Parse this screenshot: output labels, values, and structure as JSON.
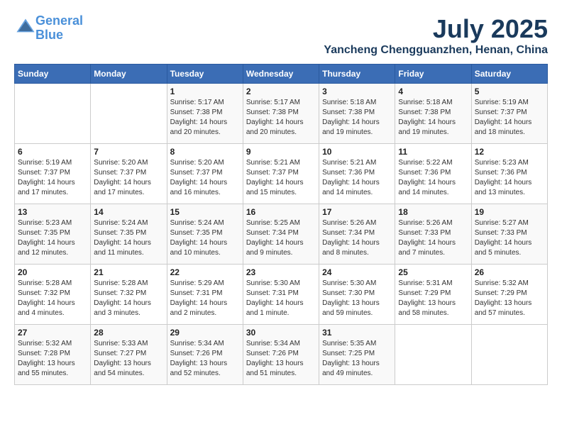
{
  "logo": {
    "line1": "General",
    "line2": "Blue"
  },
  "title": "July 2025",
  "location": "Yancheng Chengguanzhen, Henan, China",
  "days_of_week": [
    "Sunday",
    "Monday",
    "Tuesday",
    "Wednesday",
    "Thursday",
    "Friday",
    "Saturday"
  ],
  "weeks": [
    [
      {
        "day": "",
        "info": ""
      },
      {
        "day": "",
        "info": ""
      },
      {
        "day": "1",
        "info": "Sunrise: 5:17 AM\nSunset: 7:38 PM\nDaylight: 14 hours and 20 minutes."
      },
      {
        "day": "2",
        "info": "Sunrise: 5:17 AM\nSunset: 7:38 PM\nDaylight: 14 hours and 20 minutes."
      },
      {
        "day": "3",
        "info": "Sunrise: 5:18 AM\nSunset: 7:38 PM\nDaylight: 14 hours and 19 minutes."
      },
      {
        "day": "4",
        "info": "Sunrise: 5:18 AM\nSunset: 7:38 PM\nDaylight: 14 hours and 19 minutes."
      },
      {
        "day": "5",
        "info": "Sunrise: 5:19 AM\nSunset: 7:37 PM\nDaylight: 14 hours and 18 minutes."
      }
    ],
    [
      {
        "day": "6",
        "info": "Sunrise: 5:19 AM\nSunset: 7:37 PM\nDaylight: 14 hours and 17 minutes."
      },
      {
        "day": "7",
        "info": "Sunrise: 5:20 AM\nSunset: 7:37 PM\nDaylight: 14 hours and 17 minutes."
      },
      {
        "day": "8",
        "info": "Sunrise: 5:20 AM\nSunset: 7:37 PM\nDaylight: 14 hours and 16 minutes."
      },
      {
        "day": "9",
        "info": "Sunrise: 5:21 AM\nSunset: 7:37 PM\nDaylight: 14 hours and 15 minutes."
      },
      {
        "day": "10",
        "info": "Sunrise: 5:21 AM\nSunset: 7:36 PM\nDaylight: 14 hours and 14 minutes."
      },
      {
        "day": "11",
        "info": "Sunrise: 5:22 AM\nSunset: 7:36 PM\nDaylight: 14 hours and 14 minutes."
      },
      {
        "day": "12",
        "info": "Sunrise: 5:23 AM\nSunset: 7:36 PM\nDaylight: 14 hours and 13 minutes."
      }
    ],
    [
      {
        "day": "13",
        "info": "Sunrise: 5:23 AM\nSunset: 7:35 PM\nDaylight: 14 hours and 12 minutes."
      },
      {
        "day": "14",
        "info": "Sunrise: 5:24 AM\nSunset: 7:35 PM\nDaylight: 14 hours and 11 minutes."
      },
      {
        "day": "15",
        "info": "Sunrise: 5:24 AM\nSunset: 7:35 PM\nDaylight: 14 hours and 10 minutes."
      },
      {
        "day": "16",
        "info": "Sunrise: 5:25 AM\nSunset: 7:34 PM\nDaylight: 14 hours and 9 minutes."
      },
      {
        "day": "17",
        "info": "Sunrise: 5:26 AM\nSunset: 7:34 PM\nDaylight: 14 hours and 8 minutes."
      },
      {
        "day": "18",
        "info": "Sunrise: 5:26 AM\nSunset: 7:33 PM\nDaylight: 14 hours and 7 minutes."
      },
      {
        "day": "19",
        "info": "Sunrise: 5:27 AM\nSunset: 7:33 PM\nDaylight: 14 hours and 5 minutes."
      }
    ],
    [
      {
        "day": "20",
        "info": "Sunrise: 5:28 AM\nSunset: 7:32 PM\nDaylight: 14 hours and 4 minutes."
      },
      {
        "day": "21",
        "info": "Sunrise: 5:28 AM\nSunset: 7:32 PM\nDaylight: 14 hours and 3 minutes."
      },
      {
        "day": "22",
        "info": "Sunrise: 5:29 AM\nSunset: 7:31 PM\nDaylight: 14 hours and 2 minutes."
      },
      {
        "day": "23",
        "info": "Sunrise: 5:30 AM\nSunset: 7:31 PM\nDaylight: 14 hours and 1 minute."
      },
      {
        "day": "24",
        "info": "Sunrise: 5:30 AM\nSunset: 7:30 PM\nDaylight: 13 hours and 59 minutes."
      },
      {
        "day": "25",
        "info": "Sunrise: 5:31 AM\nSunset: 7:29 PM\nDaylight: 13 hours and 58 minutes."
      },
      {
        "day": "26",
        "info": "Sunrise: 5:32 AM\nSunset: 7:29 PM\nDaylight: 13 hours and 57 minutes."
      }
    ],
    [
      {
        "day": "27",
        "info": "Sunrise: 5:32 AM\nSunset: 7:28 PM\nDaylight: 13 hours and 55 minutes."
      },
      {
        "day": "28",
        "info": "Sunrise: 5:33 AM\nSunset: 7:27 PM\nDaylight: 13 hours and 54 minutes."
      },
      {
        "day": "29",
        "info": "Sunrise: 5:34 AM\nSunset: 7:26 PM\nDaylight: 13 hours and 52 minutes."
      },
      {
        "day": "30",
        "info": "Sunrise: 5:34 AM\nSunset: 7:26 PM\nDaylight: 13 hours and 51 minutes."
      },
      {
        "day": "31",
        "info": "Sunrise: 5:35 AM\nSunset: 7:25 PM\nDaylight: 13 hours and 49 minutes."
      },
      {
        "day": "",
        "info": ""
      },
      {
        "day": "",
        "info": ""
      }
    ]
  ]
}
